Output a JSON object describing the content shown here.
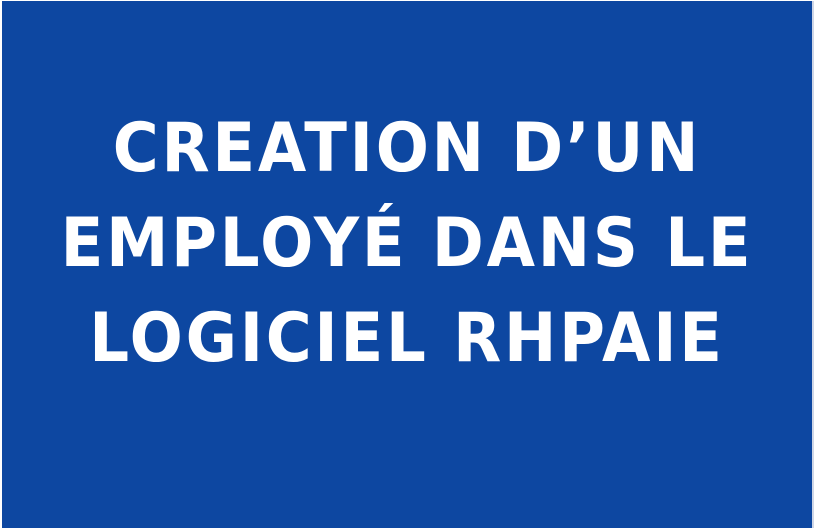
{
  "slide": {
    "background_color": "#0d47a1",
    "text_color": "#ffffff",
    "title_lines": [
      "CREATION D’UN",
      "EMPLOYÉ DANS LE",
      "LOGICIEL RHPAIE"
    ]
  }
}
